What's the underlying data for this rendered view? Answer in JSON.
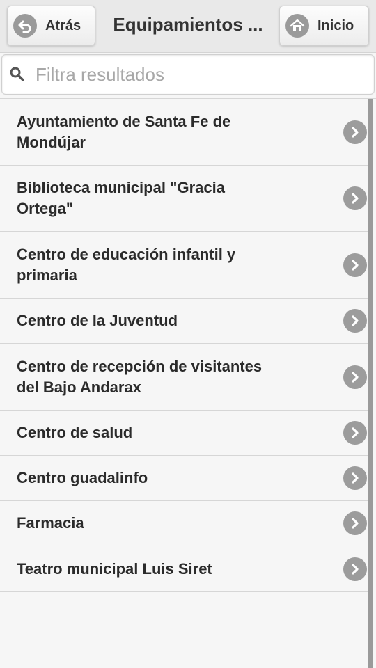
{
  "header": {
    "back_label": "Atrás",
    "title": "Equipamientos ...",
    "home_label": "Inicio"
  },
  "search": {
    "placeholder": "Filtra resultados",
    "value": ""
  },
  "list": {
    "items": [
      {
        "label": "Ayuntamiento de Santa Fe de Mondújar"
      },
      {
        "label": "Biblioteca municipal \"Gracia Ortega\""
      },
      {
        "label": "Centro de educación infantil y primaria"
      },
      {
        "label": "Centro de la Juventud"
      },
      {
        "label": "Centro de recepción de visitantes del Bajo Andarax"
      },
      {
        "label": "Centro de salud"
      },
      {
        "label": "Centro guadalinfo"
      },
      {
        "label": "Farmacia"
      },
      {
        "label": "Teatro municipal Luis Siret"
      }
    ]
  }
}
